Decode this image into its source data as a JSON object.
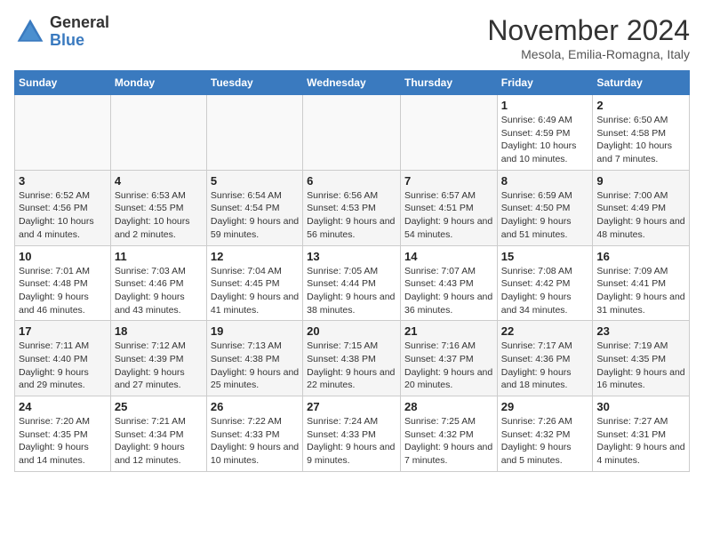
{
  "logo": {
    "line1": "General",
    "line2": "Blue"
  },
  "title": "November 2024",
  "subtitle": "Mesola, Emilia-Romagna, Italy",
  "days_of_week": [
    "Sunday",
    "Monday",
    "Tuesday",
    "Wednesday",
    "Thursday",
    "Friday",
    "Saturday"
  ],
  "weeks": [
    [
      {
        "day": "",
        "info": ""
      },
      {
        "day": "",
        "info": ""
      },
      {
        "day": "",
        "info": ""
      },
      {
        "day": "",
        "info": ""
      },
      {
        "day": "",
        "info": ""
      },
      {
        "day": "1",
        "info": "Sunrise: 6:49 AM\nSunset: 4:59 PM\nDaylight: 10 hours and 10 minutes."
      },
      {
        "day": "2",
        "info": "Sunrise: 6:50 AM\nSunset: 4:58 PM\nDaylight: 10 hours and 7 minutes."
      }
    ],
    [
      {
        "day": "3",
        "info": "Sunrise: 6:52 AM\nSunset: 4:56 PM\nDaylight: 10 hours and 4 minutes."
      },
      {
        "day": "4",
        "info": "Sunrise: 6:53 AM\nSunset: 4:55 PM\nDaylight: 10 hours and 2 minutes."
      },
      {
        "day": "5",
        "info": "Sunrise: 6:54 AM\nSunset: 4:54 PM\nDaylight: 9 hours and 59 minutes."
      },
      {
        "day": "6",
        "info": "Sunrise: 6:56 AM\nSunset: 4:53 PM\nDaylight: 9 hours and 56 minutes."
      },
      {
        "day": "7",
        "info": "Sunrise: 6:57 AM\nSunset: 4:51 PM\nDaylight: 9 hours and 54 minutes."
      },
      {
        "day": "8",
        "info": "Sunrise: 6:59 AM\nSunset: 4:50 PM\nDaylight: 9 hours and 51 minutes."
      },
      {
        "day": "9",
        "info": "Sunrise: 7:00 AM\nSunset: 4:49 PM\nDaylight: 9 hours and 48 minutes."
      }
    ],
    [
      {
        "day": "10",
        "info": "Sunrise: 7:01 AM\nSunset: 4:48 PM\nDaylight: 9 hours and 46 minutes."
      },
      {
        "day": "11",
        "info": "Sunrise: 7:03 AM\nSunset: 4:46 PM\nDaylight: 9 hours and 43 minutes."
      },
      {
        "day": "12",
        "info": "Sunrise: 7:04 AM\nSunset: 4:45 PM\nDaylight: 9 hours and 41 minutes."
      },
      {
        "day": "13",
        "info": "Sunrise: 7:05 AM\nSunset: 4:44 PM\nDaylight: 9 hours and 38 minutes."
      },
      {
        "day": "14",
        "info": "Sunrise: 7:07 AM\nSunset: 4:43 PM\nDaylight: 9 hours and 36 minutes."
      },
      {
        "day": "15",
        "info": "Sunrise: 7:08 AM\nSunset: 4:42 PM\nDaylight: 9 hours and 34 minutes."
      },
      {
        "day": "16",
        "info": "Sunrise: 7:09 AM\nSunset: 4:41 PM\nDaylight: 9 hours and 31 minutes."
      }
    ],
    [
      {
        "day": "17",
        "info": "Sunrise: 7:11 AM\nSunset: 4:40 PM\nDaylight: 9 hours and 29 minutes."
      },
      {
        "day": "18",
        "info": "Sunrise: 7:12 AM\nSunset: 4:39 PM\nDaylight: 9 hours and 27 minutes."
      },
      {
        "day": "19",
        "info": "Sunrise: 7:13 AM\nSunset: 4:38 PM\nDaylight: 9 hours and 25 minutes."
      },
      {
        "day": "20",
        "info": "Sunrise: 7:15 AM\nSunset: 4:38 PM\nDaylight: 9 hours and 22 minutes."
      },
      {
        "day": "21",
        "info": "Sunrise: 7:16 AM\nSunset: 4:37 PM\nDaylight: 9 hours and 20 minutes."
      },
      {
        "day": "22",
        "info": "Sunrise: 7:17 AM\nSunset: 4:36 PM\nDaylight: 9 hours and 18 minutes."
      },
      {
        "day": "23",
        "info": "Sunrise: 7:19 AM\nSunset: 4:35 PM\nDaylight: 9 hours and 16 minutes."
      }
    ],
    [
      {
        "day": "24",
        "info": "Sunrise: 7:20 AM\nSunset: 4:35 PM\nDaylight: 9 hours and 14 minutes."
      },
      {
        "day": "25",
        "info": "Sunrise: 7:21 AM\nSunset: 4:34 PM\nDaylight: 9 hours and 12 minutes."
      },
      {
        "day": "26",
        "info": "Sunrise: 7:22 AM\nSunset: 4:33 PM\nDaylight: 9 hours and 10 minutes."
      },
      {
        "day": "27",
        "info": "Sunrise: 7:24 AM\nSunset: 4:33 PM\nDaylight: 9 hours and 9 minutes."
      },
      {
        "day": "28",
        "info": "Sunrise: 7:25 AM\nSunset: 4:32 PM\nDaylight: 9 hours and 7 minutes."
      },
      {
        "day": "29",
        "info": "Sunrise: 7:26 AM\nSunset: 4:32 PM\nDaylight: 9 hours and 5 minutes."
      },
      {
        "day": "30",
        "info": "Sunrise: 7:27 AM\nSunset: 4:31 PM\nDaylight: 9 hours and 4 minutes."
      }
    ]
  ]
}
